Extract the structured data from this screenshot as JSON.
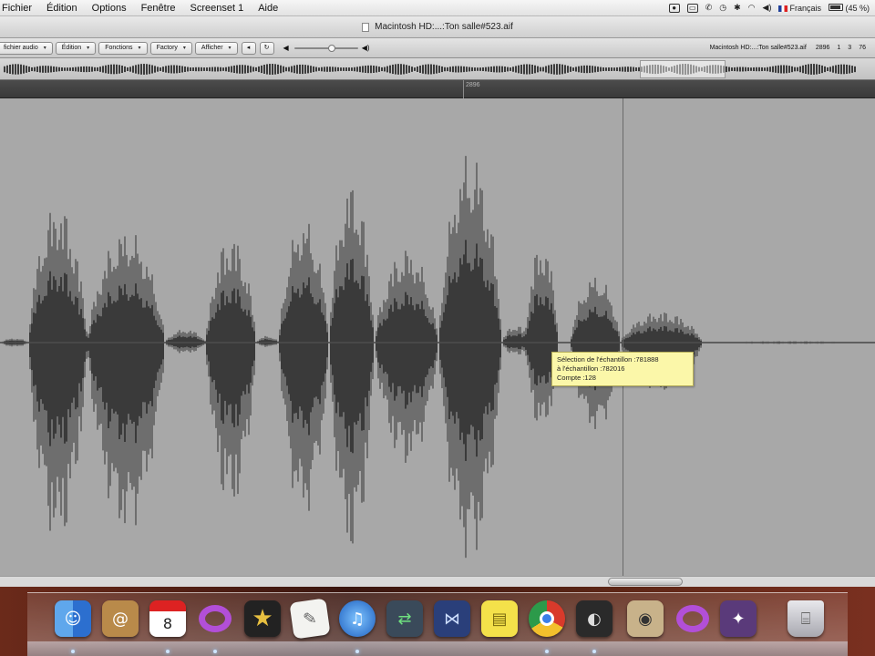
{
  "menubar": {
    "menus": [
      "Fichier",
      "Édition",
      "Options",
      "Fenêtre",
      "Screenset 1",
      "Aide"
    ],
    "language": "Français",
    "battery_label": "(45 %)"
  },
  "window": {
    "title": "Macintosh HD:...:Ton salle#523.aif"
  },
  "toolbar": {
    "buttons": [
      "fichier audio",
      "Édition",
      "Fonctions",
      "Factory",
      "Afficher"
    ],
    "file_label": "Macintosh HD:...:Ton salle#523.aif",
    "counter": [
      "2896",
      "1",
      "3",
      "76"
    ],
    "volume_level": 0.6
  },
  "ruler": {
    "marker": "2896"
  },
  "tooltip": {
    "line1": "Sélection de l'échantillon :781888",
    "line2": "à l'échantillon :782016",
    "line3": "Compte :128"
  },
  "dock": {
    "items": [
      "finder-icon",
      "address-book-icon",
      "calendar-icon",
      "opera-icon",
      "imovie-icon",
      "textedit-icon",
      "itunes-icon",
      "screen-sharing-icon",
      "network-utility-icon",
      "stickies-icon",
      "chrome-icon",
      "logic-icon",
      "speaker-icon",
      "opera-icon",
      "photo-booth-icon",
      "trash-icon"
    ],
    "calendar_day": "8"
  },
  "colors": {
    "waveform_background": "#a8a8a8",
    "waveform_dark": "#3a3a3a",
    "waveform_light": "#6e6e6e",
    "tooltip_background": "#fbf7a9"
  }
}
